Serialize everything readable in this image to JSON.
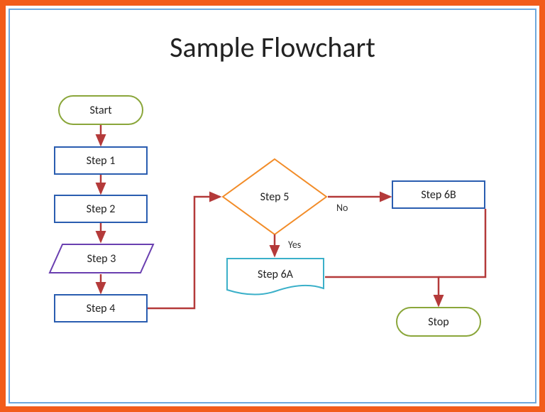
{
  "title": "Sample Flowchart",
  "nodes": {
    "start": "Start",
    "step1": "Step 1",
    "step2": "Step 2",
    "step3": "Step 3",
    "step4": "Step 4",
    "step5": "Step 5",
    "step6a": "Step 6A",
    "step6b": "Step 6B",
    "stop": "Stop"
  },
  "edges": {
    "yes": "Yes",
    "no": "No"
  },
  "colors": {
    "frame_outer": "#f25c1a",
    "frame_inner": "#6fa8dc",
    "terminator_border": "#8aa63a",
    "process_border": "#2a5db0",
    "decision_border": "#f28c28",
    "parallelogram_border": "#6a3fb0",
    "document_border": "#3bb0c9",
    "arrow": "#b43a3a"
  }
}
